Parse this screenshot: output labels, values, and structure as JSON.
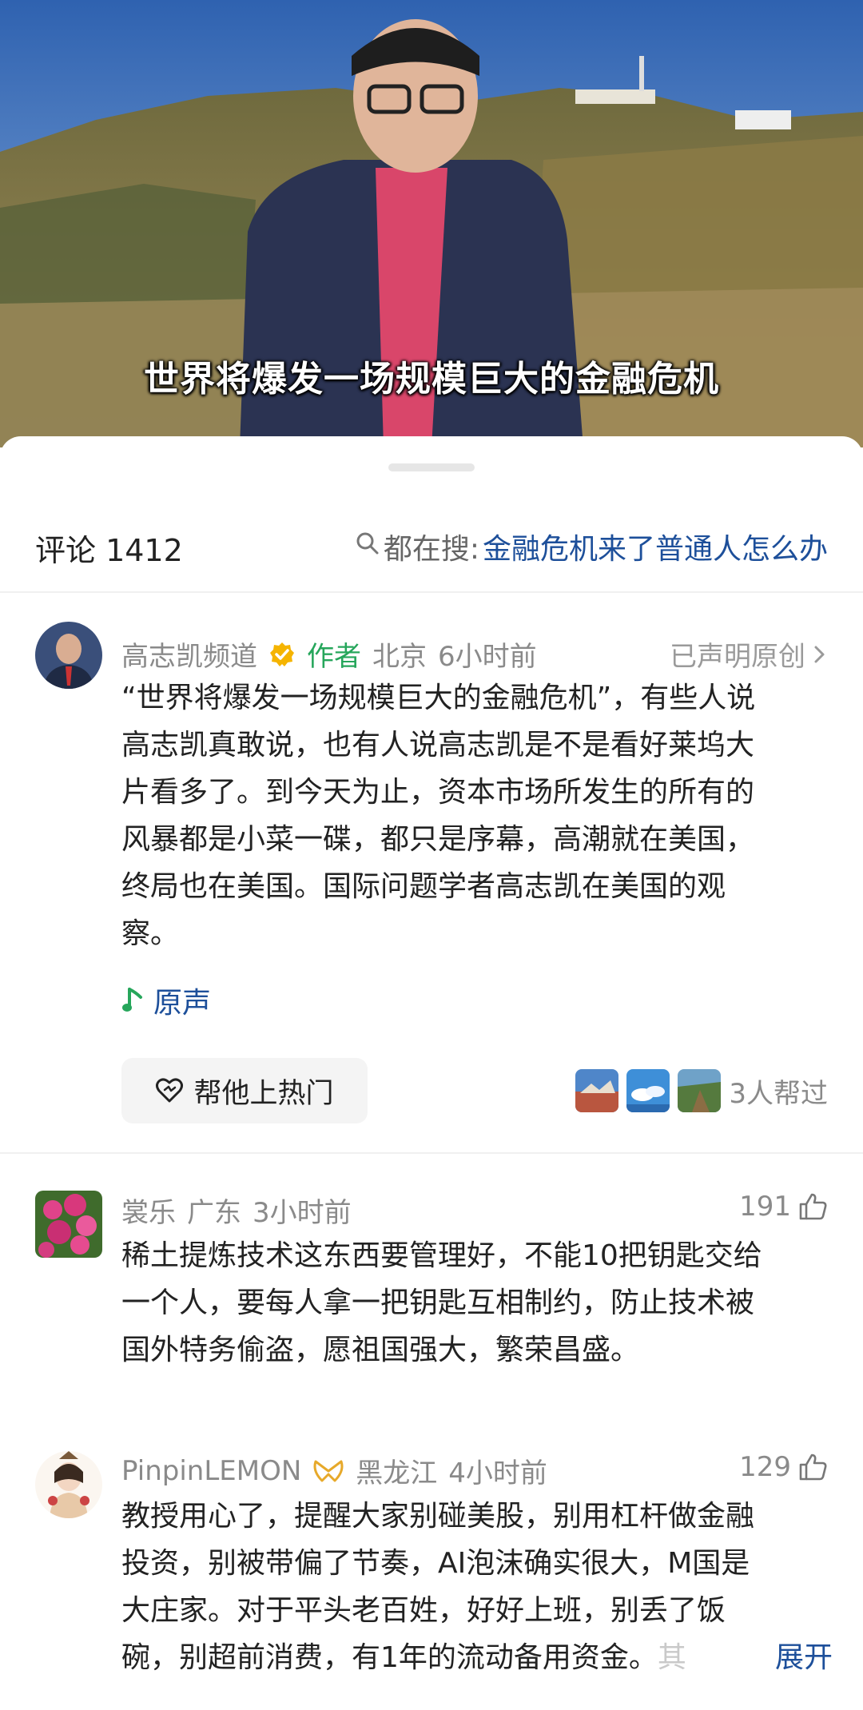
{
  "video": {
    "caption": "世界将爆发一场规模巨大的金融危机"
  },
  "header": {
    "comment_label": "评论 1412",
    "search_prefix": "都在搜:",
    "search_keyword": "金融危机来了普通人怎么办"
  },
  "author_comment": {
    "name": "高志凯频道",
    "author_tag": "作者",
    "location": "北京",
    "time": "6小时前",
    "claimed_label": "已声明原创",
    "lines": [
      "“世界将爆发一场规模巨大的金融危机”，有些人说",
      "高志凯真敢说，也有人说高志凯是不是看好莱坞大",
      "片看多了。到今天为止，资本市场所发生的所有的",
      "风暴都是小菜一碟，都只是序幕，高潮就在美国，",
      "终局也在美国。国际问题学者高志凯在美国的观",
      "察。"
    ],
    "sound_label": "原声",
    "boost_label": "帮他上热门",
    "helpers_label": "3人帮过"
  },
  "comments": [
    {
      "name": "裳乐",
      "location": "广东",
      "time": "3小时前",
      "likes": "191",
      "lines": [
        "稀土提炼技术这东西要管理好，不能10把钥匙交给",
        "一个人，要每人拿一把钥匙互相制约，防止技术被",
        "国外特务偷盗，愿祖国强大，繁荣昌盛。"
      ]
    },
    {
      "name": "PinpinLEMON",
      "location": "黑龙江",
      "time": "4小时前",
      "likes": "129",
      "lines": [
        "教授用心了，提醒大家别碰美股，别用杠杆做金融",
        "投资，别被带偏了节奏，AI泡沫确实很大，M国是",
        "大庄家。对于平头老百姓，好好上班，别丢了饭"
      ],
      "last_line": "碗，别超前消费，有1年的流动备用资金。",
      "last_fade": "其",
      "expand_label": "展开"
    }
  ],
  "colors": {
    "accent_blue": "#1d4f9a",
    "author_green": "#26a65b",
    "verified_gold": "#f5b400"
  },
  "icons": [
    "search-icon",
    "verified-badge-icon",
    "chevron-right-icon",
    "music-note-icon",
    "heart-boost-icon",
    "thumbs-up-icon",
    "badge-icon"
  ]
}
